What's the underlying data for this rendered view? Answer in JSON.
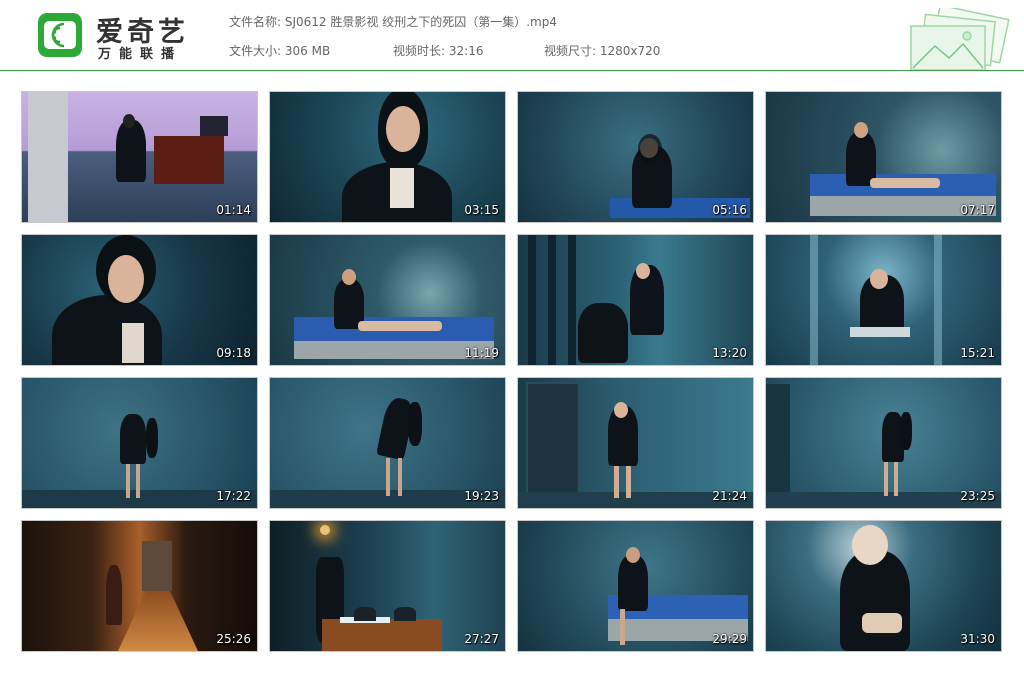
{
  "app": {
    "name": "爱奇艺",
    "subtitle": "万能联播"
  },
  "meta": {
    "filename_label": "文件名称:",
    "filename_value": "SJ0612 胜景影视 绞刑之下的死囚（第一集）.mp4",
    "size_label": "文件大小:",
    "size_value": "306 MB",
    "duration_label": "视频时长:",
    "duration_value": "32:16",
    "dimension_label": "视频尺寸:",
    "dimension_value": "1280x720"
  },
  "colors": {
    "brand_green": "#2ca937",
    "divider": "#3fa14a"
  },
  "thumbnails": [
    {
      "time": "01:14",
      "scene": "office-kneeling"
    },
    {
      "time": "03:15",
      "scene": "closeup-face"
    },
    {
      "time": "05:16",
      "scene": "sitting-bed"
    },
    {
      "time": "07:17",
      "scene": "lying-bed"
    },
    {
      "time": "09:18",
      "scene": "closeup-down"
    },
    {
      "time": "11:19",
      "scene": "lying-bed-2"
    },
    {
      "time": "13:20",
      "scene": "bars-two-people"
    },
    {
      "time": "15:21",
      "scene": "seated-chair"
    },
    {
      "time": "17:22",
      "scene": "wall-standing"
    },
    {
      "time": "19:23",
      "scene": "wall-bent"
    },
    {
      "time": "21:24",
      "scene": "door-standing"
    },
    {
      "time": "23:25",
      "scene": "wall-standing-2"
    },
    {
      "time": "25:26",
      "scene": "corridor"
    },
    {
      "time": "27:27",
      "scene": "table-chairs"
    },
    {
      "time": "29:29",
      "scene": "bed-sitting-2"
    },
    {
      "time": "31:30",
      "scene": "floor-sitting-light"
    }
  ]
}
